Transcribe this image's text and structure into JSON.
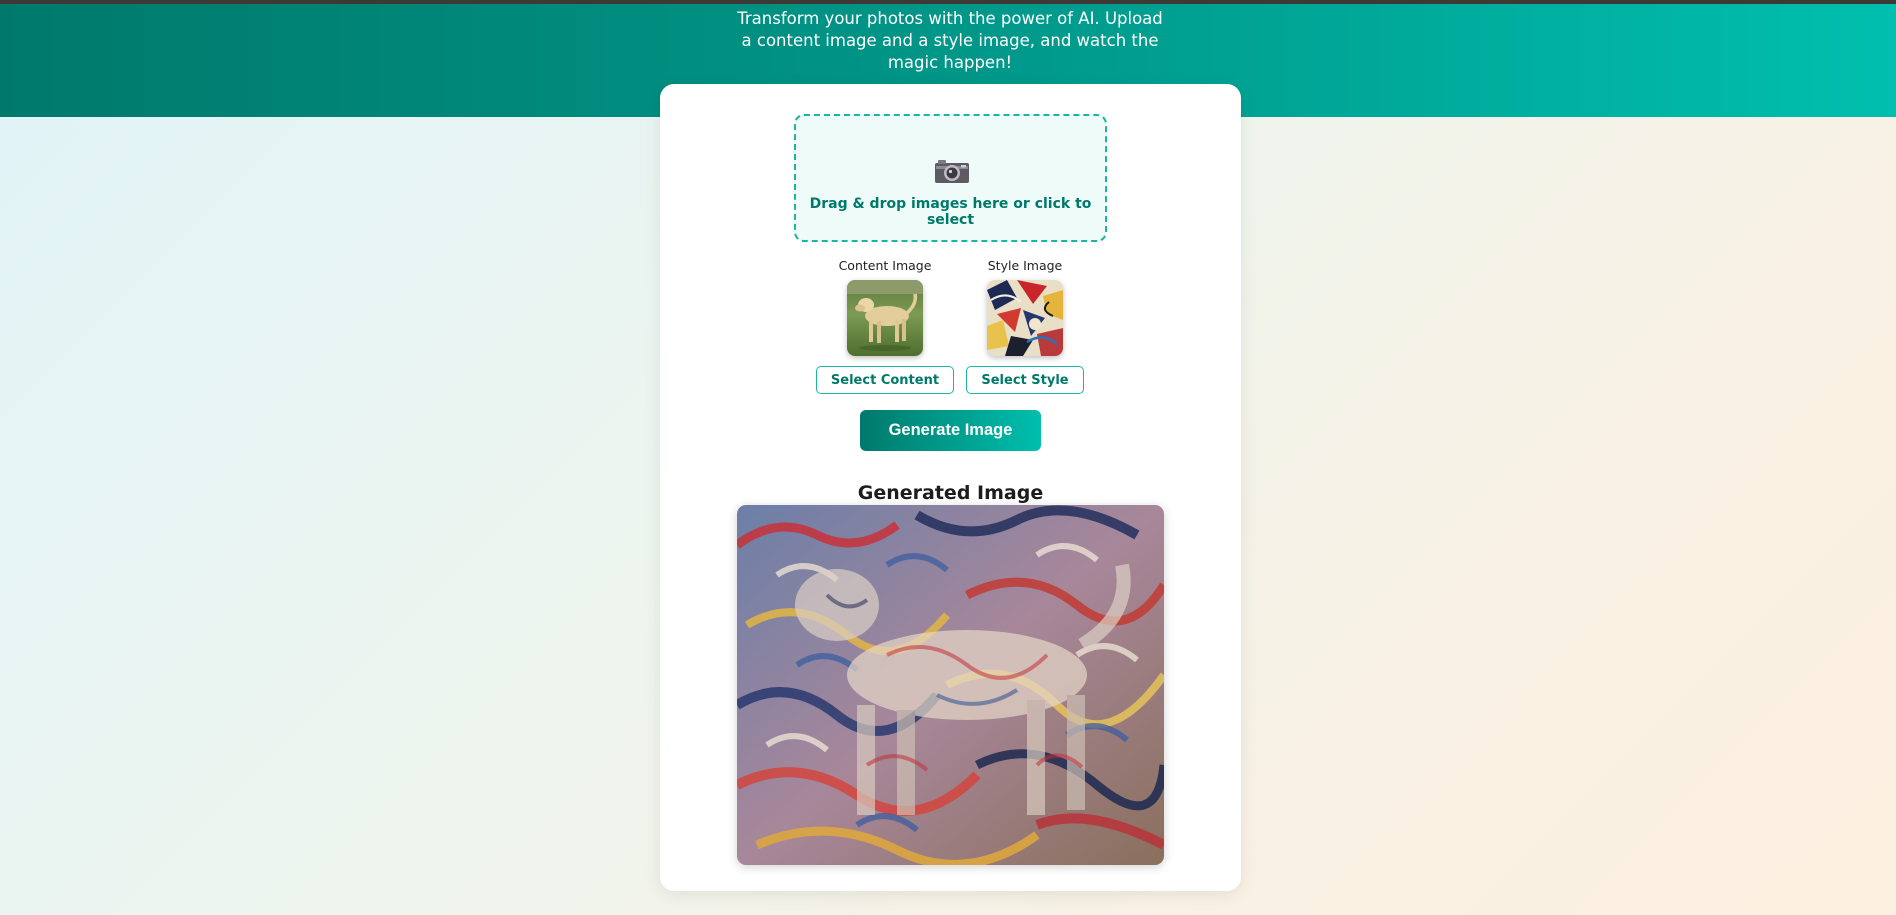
{
  "header": {
    "description": "Transform your photos with the power of AI. Upload a content image and a style image, and watch the magic happen!"
  },
  "dropzone": {
    "icon": "camera-icon",
    "text": "Drag & drop images here or click to select"
  },
  "content_slot": {
    "label": "Content Image",
    "button": "Select Content"
  },
  "style_slot": {
    "label": "Style Image",
    "button": "Select Style"
  },
  "actions": {
    "generate": "Generate Image"
  },
  "result": {
    "title": "Generated Image"
  },
  "colors": {
    "accent_dark": "#00796b",
    "accent_light": "#00bfae",
    "dropzone_border": "#1bb5a4"
  }
}
